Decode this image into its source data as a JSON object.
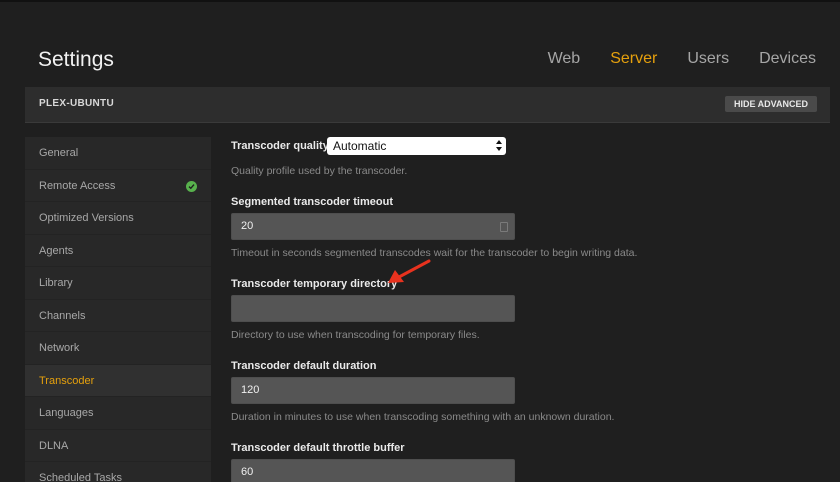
{
  "header": {
    "title": "Settings",
    "tabs": [
      {
        "label": "Web"
      },
      {
        "label": "Server"
      },
      {
        "label": "Users"
      },
      {
        "label": "Devices"
      }
    ]
  },
  "server_bar": {
    "name": "PLEX-UBUNTU",
    "hide_advanced_label": "HIDE ADVANCED"
  },
  "sidebar": {
    "items": [
      {
        "label": "General"
      },
      {
        "label": "Remote Access",
        "status": "check-icon"
      },
      {
        "label": "Optimized Versions"
      },
      {
        "label": "Agents"
      },
      {
        "label": "Library"
      },
      {
        "label": "Channels"
      },
      {
        "label": "Network"
      },
      {
        "label": "Transcoder",
        "active": true
      },
      {
        "label": "Languages"
      },
      {
        "label": "DLNA"
      },
      {
        "label": "Scheduled Tasks"
      }
    ]
  },
  "fields": {
    "quality": {
      "label": "Transcoder quality",
      "value": "Automatic",
      "help": "Quality profile used by the transcoder."
    },
    "segmented_timeout": {
      "label": "Segmented transcoder timeout",
      "value": "20",
      "help": "Timeout in seconds segmented transcodes wait for the transcoder to begin writing data."
    },
    "temp_dir": {
      "label": "Transcoder temporary directory",
      "value": "",
      "help": "Directory to use when transcoding for temporary files."
    },
    "default_duration": {
      "label": "Transcoder default duration",
      "value": "120",
      "help": "Duration in minutes to use when transcoding something with an unknown duration."
    },
    "throttle_buffer": {
      "label": "Transcoder default throttle buffer",
      "value": "60"
    }
  },
  "colors": {
    "accent": "#e5a00d",
    "annotation_arrow": "#e8321e",
    "success": "#58b14d"
  }
}
